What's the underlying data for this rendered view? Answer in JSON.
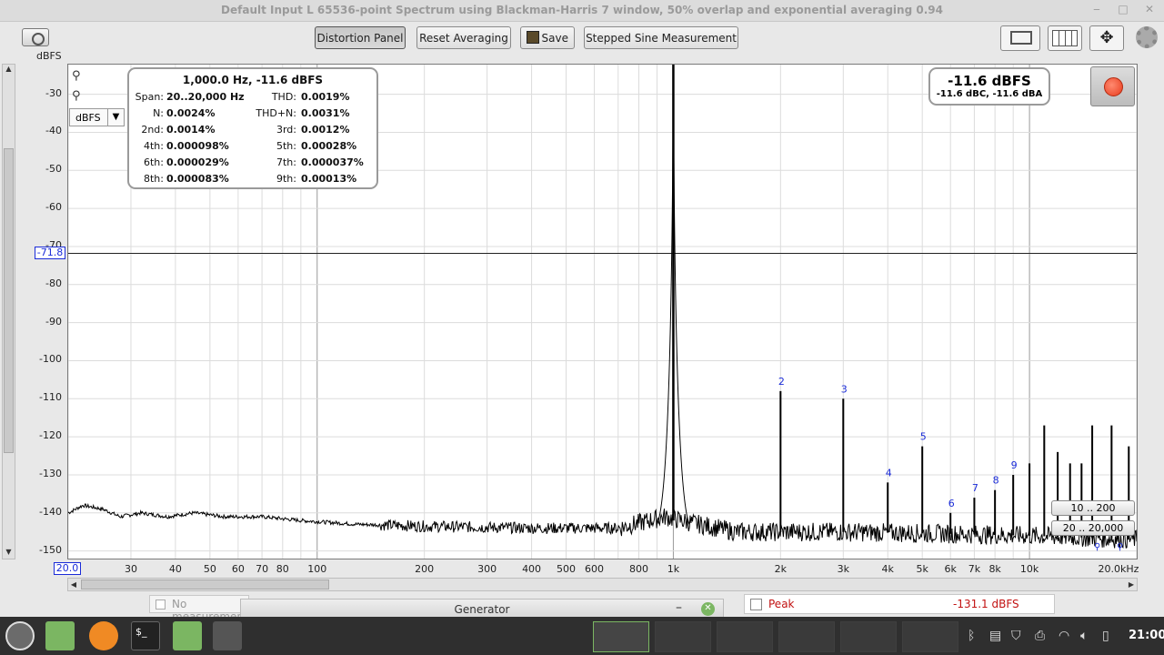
{
  "window": {
    "title": "Default Input L 65536-point Spectrum using Blackman-Harris 7 window, 50% overlap and exponential averaging 0.94"
  },
  "toolbar": {
    "y_unit": "dBFS",
    "distortion_panel_label": "Distortion Panel",
    "reset_averaging_label": "Reset Averaging",
    "save_label": "Save",
    "stepped_sine_label": "Stepped Sine Measurement"
  },
  "unit_select": {
    "value": "dBFS"
  },
  "distortion_panel": {
    "header": "1,000.0 Hz, -11.6 dBFS",
    "rows": [
      {
        "k1": "Span:",
        "v1": "20..20,000 Hz",
        "k2": "THD:",
        "v2": "0.0019%"
      },
      {
        "k1": "N:",
        "v1": "0.0024%",
        "k2": "THD+N:",
        "v2": "0.0031%"
      },
      {
        "k1": "2nd:",
        "v1": "0.0014%",
        "k2": "3rd:",
        "v2": "0.0012%"
      },
      {
        "k1": "4th:",
        "v1": "0.000098%",
        "k2": "5th:",
        "v2": "0.00028%"
      },
      {
        "k1": "6th:",
        "v1": "0.000029%",
        "k2": "7th:",
        "v2": "0.000037%"
      },
      {
        "k1": "8th:",
        "v1": "0.000083%",
        "k2": "9th:",
        "v2": "0.00013%"
      }
    ]
  },
  "level_readout": {
    "main": "-11.6 dBFS",
    "sub": "-11.6 dBC, -11.6 dBA"
  },
  "range_buttons": [
    "10 .. 200",
    "20 .. 20,000"
  ],
  "cursor": {
    "y_value": "-71.8",
    "x_value": "20.0"
  },
  "bottom": {
    "no_measurement": "No measurement",
    "generator": "Generator",
    "peak_label": "Peak",
    "peak_value": "-131.1 dBFS"
  },
  "clock": "21:00",
  "chart_data": {
    "type": "line",
    "x_scale": "log",
    "xlim": [
      20,
      20000
    ],
    "ylim": [
      -150,
      -20
    ],
    "x_ticks": [
      {
        "v": 30,
        "label": "30"
      },
      {
        "v": 40,
        "label": "40"
      },
      {
        "v": 50,
        "label": "50"
      },
      {
        "v": 60,
        "label": "60"
      },
      {
        "v": 70,
        "label": "70"
      },
      {
        "v": 80,
        "label": "80"
      },
      {
        "v": 100,
        "label": "100"
      },
      {
        "v": 200,
        "label": "200"
      },
      {
        "v": 300,
        "label": "300"
      },
      {
        "v": 400,
        "label": "400"
      },
      {
        "v": 500,
        "label": "500"
      },
      {
        "v": 600,
        "label": "600"
      },
      {
        "v": 800,
        "label": "800"
      },
      {
        "v": 1000,
        "label": "1k"
      },
      {
        "v": 2000,
        "label": "2k"
      },
      {
        "v": 3000,
        "label": "3k"
      },
      {
        "v": 4000,
        "label": "4k"
      },
      {
        "v": 5000,
        "label": "5k"
      },
      {
        "v": 6000,
        "label": "6k"
      },
      {
        "v": 7000,
        "label": "7k"
      },
      {
        "v": 8000,
        "label": "8k"
      },
      {
        "v": 10000,
        "label": "10k"
      },
      {
        "v": 20000,
        "label": "20.0kHz"
      }
    ],
    "y_ticks": [
      -30,
      -40,
      -50,
      -60,
      -70,
      -80,
      -90,
      -100,
      -110,
      -120,
      -130,
      -140,
      -150
    ],
    "cursor_level": -71.8,
    "noise_floor": [
      [
        20,
        -140
      ],
      [
        22,
        -138
      ],
      [
        25,
        -139
      ],
      [
        28,
        -141
      ],
      [
        32,
        -140
      ],
      [
        38,
        -141
      ],
      [
        45,
        -140
      ],
      [
        55,
        -141
      ],
      [
        70,
        -141
      ],
      [
        90,
        -142
      ],
      [
        130,
        -143
      ],
      [
        200,
        -143.5
      ],
      [
        400,
        -144
      ],
      [
        700,
        -144
      ],
      [
        950,
        -141
      ],
      [
        1050,
        -142
      ],
      [
        1500,
        -145
      ],
      [
        3000,
        -145
      ],
      [
        6000,
        -145.5
      ],
      [
        10000,
        -146
      ],
      [
        20000,
        -147
      ]
    ],
    "fundamental": {
      "x": 1000,
      "y": -11.6
    },
    "harmonics": [
      {
        "n": "2",
        "x": 2000,
        "y": -108
      },
      {
        "n": "3",
        "x": 3000,
        "y": -110
      },
      {
        "n": "4",
        "x": 4000,
        "y": -132
      },
      {
        "n": "5",
        "x": 5000,
        "y": -122.5
      },
      {
        "n": "6",
        "x": 6000,
        "y": -140
      },
      {
        "n": "7",
        "x": 7000,
        "y": -136
      },
      {
        "n": "8",
        "x": 8000,
        "y": -134
      },
      {
        "n": "9",
        "x": 9000,
        "y": -130
      }
    ],
    "other_peaks": [
      {
        "x": 10000,
        "y": -127
      },
      {
        "x": 11000,
        "y": -117
      },
      {
        "x": 12000,
        "y": -124
      },
      {
        "x": 13000,
        "y": -127
      },
      {
        "x": 14000,
        "y": -127
      },
      {
        "x": 15000,
        "y": -117
      },
      {
        "x": 17000,
        "y": -117
      },
      {
        "x": 19000,
        "y": -122.5
      }
    ]
  }
}
